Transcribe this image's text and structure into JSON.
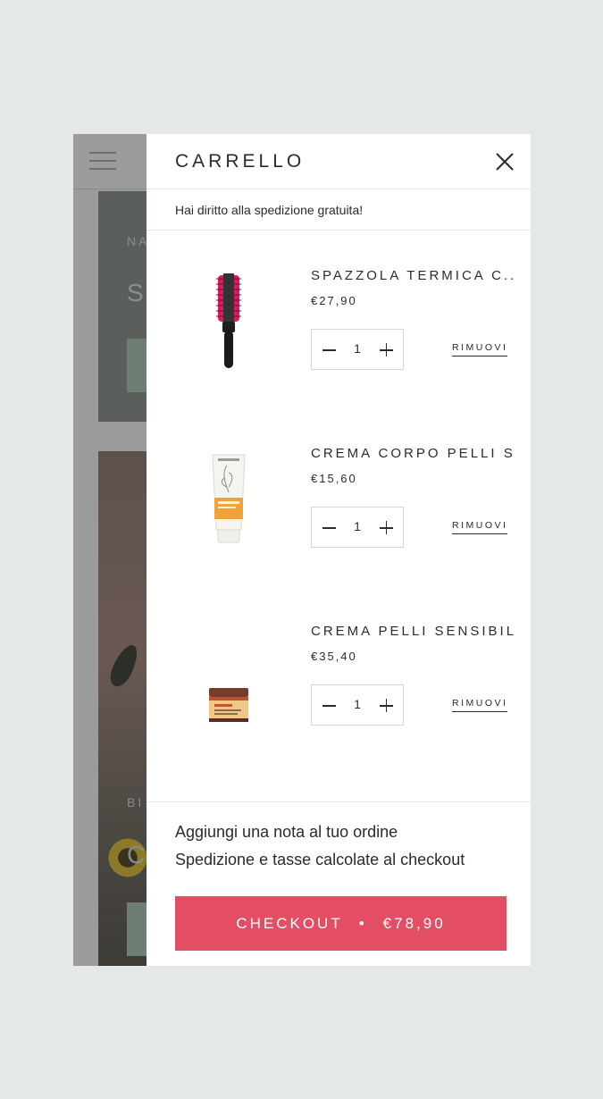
{
  "cart": {
    "title": "CARRELLO",
    "close_icon": "close-icon",
    "notice": "Hai diritto alla spedizione gratuita!",
    "items": [
      {
        "name": "SPAZZOLA TERMICA C...",
        "price": "€27,90",
        "quantity": "1",
        "remove_label": "RIMUOVI",
        "image": "round-brush"
      },
      {
        "name": "CREMA CORPO PELLI S...",
        "price": "€15,60",
        "quantity": "1",
        "remove_label": "RIMUOVI",
        "image": "cream-tube"
      },
      {
        "name": "CREMA PELLI SENSIBILI",
        "price": "€35,40",
        "quantity": "1",
        "remove_label": "RIMUOVI",
        "image": "cream-jar"
      }
    ],
    "note_label": "Aggiungi una nota al tuo ordine",
    "shipping_text": "Spedizione e tasse calcolate al checkout",
    "checkout_label": "CHECKOUT",
    "checkout_separator": "•",
    "total": "€78,90"
  },
  "background_page": {
    "card1_eyebrow": "NA",
    "card1_heading": "S",
    "card2_eyebrow": "BI",
    "card2_heading": "C"
  },
  "colors": {
    "checkout_button": "#e44e64",
    "background": "#e4e9e7",
    "overlay": "#9b9b9b"
  }
}
